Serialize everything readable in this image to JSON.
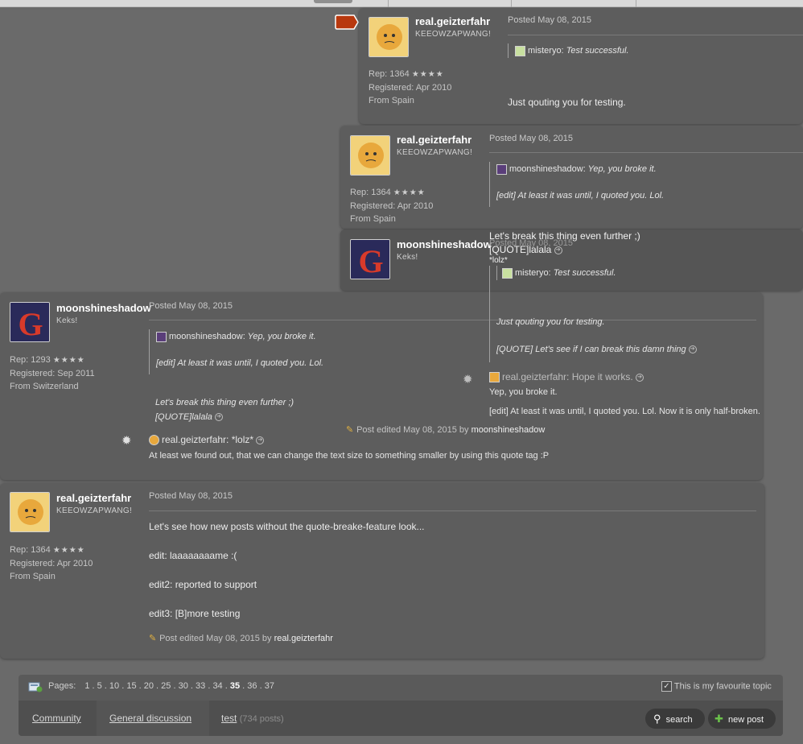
{
  "quote1": {
    "author": {
      "name": "real.geizterfahr",
      "subtitle": "KEEOWZAPWANG!",
      "rep": "Rep: 1364",
      "registered": "Registered: Apr 2010",
      "location": "From Spain"
    },
    "posted": "Posted May 08, 2015",
    "inner_quote": {
      "name": "misteryo:",
      "text": "Test successful."
    },
    "text": "Just qouting you for testing."
  },
  "quote2": {
    "author": {
      "name": "real.geizterfahr",
      "subtitle": "KEEOWZAPWANG!",
      "rep": "Rep: 1364",
      "registered": "Registered: Apr 2010",
      "location": "From Spain"
    },
    "posted": "Posted May 08, 2015",
    "inner_quote": {
      "name": "moonshineshadow:",
      "text": "Yep, you broke it."
    },
    "inner_edit": "[edit] At least it was until, I quoted you. Lol."
  },
  "quote3": {
    "author": {
      "name": "moonshineshadow",
      "subtitle": "Keks!"
    },
    "posted": "Posted May 08, 2015",
    "line1": "Let's break this thing even further ;)",
    "line2": "[QUOTE]lalala",
    "line3": "*lolz*",
    "inner_quote": {
      "name": "misteryo:",
      "text": "Test successful."
    },
    "text1": "Just qouting you for testing.",
    "text2": "[QUOTE] Let's see if I can break this damn thing",
    "broken_quote": {
      "name": "real.geizterfahr:",
      "text": "Hope it works."
    },
    "broken1": "Yep, you broke it.",
    "broken2": "[edit] At least it was until, I quoted you. Lol. Now it is only half-broken."
  },
  "post1": {
    "author": {
      "name": "moonshineshadow",
      "subtitle": "Keks!",
      "rep": "Rep: 1293",
      "registered": "Registered: Sep 2011",
      "location": "From Switzerland"
    },
    "posted": "Posted May 08, 2015",
    "inner_quote": {
      "name": "moonshineshadow:",
      "text": "Yep, you broke it."
    },
    "inner_edit": "[edit] At least it was until, I quoted you. Lol.",
    "line1": "Let's break this thing even further ;)",
    "line2": "[QUOTE]lalala",
    "edited_prefix": "Post edited May 08, 2015 by",
    "edited_by": "moonshineshadow",
    "quote": {
      "name": "real.geizterfahr:",
      "text": "*lolz*"
    },
    "text": "At least we found out, that we can change the text size to something smaller by using this quote tag :P"
  },
  "post2": {
    "author": {
      "name": "real.geizterfahr",
      "subtitle": "KEEOWZAPWANG!",
      "rep": "Rep: 1364",
      "registered": "Registered: Apr 2010",
      "location": "From Spain"
    },
    "posted": "Posted May 08, 2015",
    "lines": [
      "Let's see how new posts without the quote-breake-feature look...",
      "edit: laaaaaaaame :(",
      "edit2: reported to support",
      "edit3: [B]more testing"
    ],
    "edited_prefix": "Post edited May 08, 2015 by",
    "edited_by": "real.geizterfahr"
  },
  "pager": {
    "label": "Pages:",
    "pages": [
      "1",
      "5",
      "10",
      "15",
      "20",
      "25",
      "30",
      "33",
      "34",
      "35",
      "36",
      "37"
    ],
    "current": "35",
    "favourite": "This is my favourite topic"
  },
  "breadcrumb": {
    "community": "Community",
    "general": "General discussion",
    "topic": "test",
    "count": "(734 posts)"
  },
  "buttons": {
    "search": "search",
    "new_post": "new post"
  },
  "icons": {
    "stars": "★★★★",
    "arrow": "➔",
    "gear": "✹",
    "pencil": "✎",
    "check": "✓",
    "plus": "✚",
    "magnifier": "⚲"
  },
  "colors": {
    "background": "#6a6a6a",
    "panel": "#5d5d5d",
    "reply_flag": "#b8380e",
    "new_post_plus": "#6ac14a"
  }
}
